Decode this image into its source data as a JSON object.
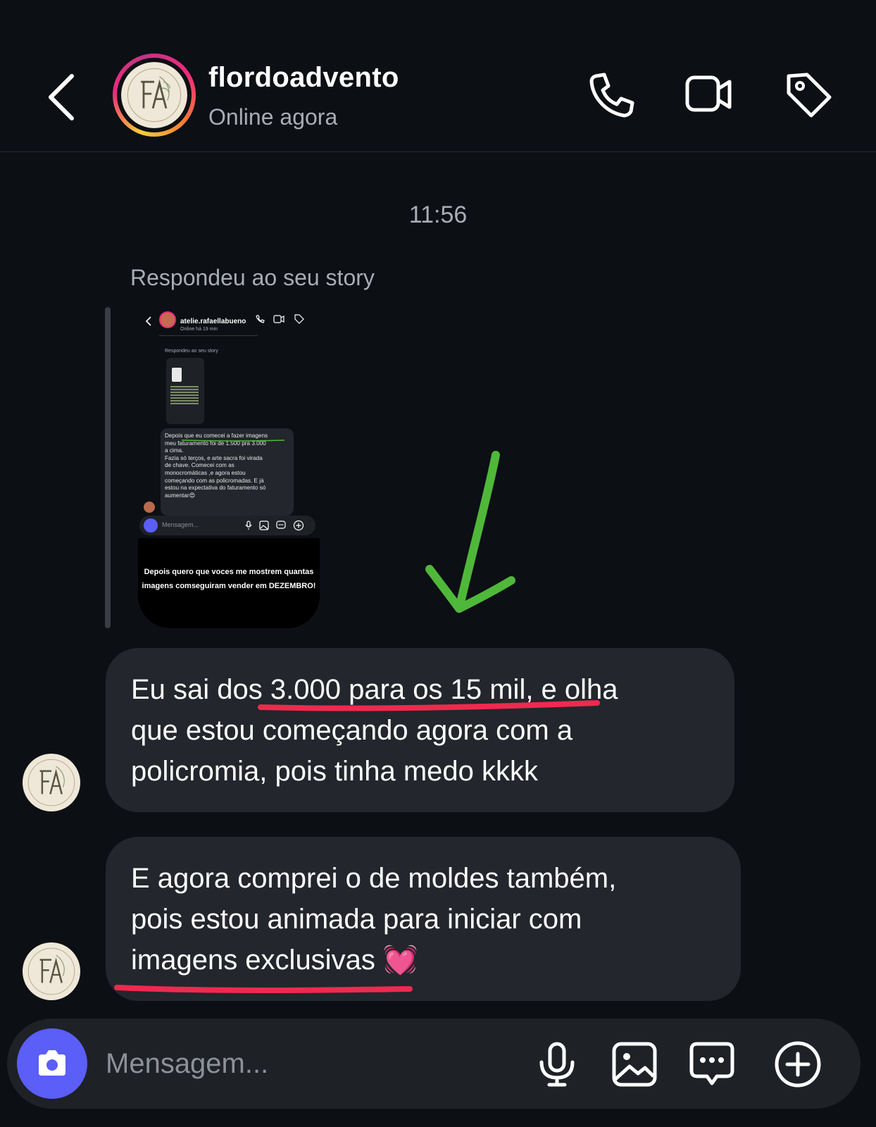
{
  "header": {
    "username": "flordoadvento",
    "status": "Online agora",
    "icons": [
      "back-chevron-icon",
      "phone-icon",
      "video-icon",
      "tag-icon"
    ]
  },
  "chat": {
    "timestamp": "11:56",
    "reply_label": "Respondeu ao seu story",
    "story_preview": {
      "username": "atelie.rafaellabueno",
      "status": "Online há 19 min",
      "reply_label": "Respondeu ao seu story",
      "message": "Depois que eu comecei a fazer imagens\nmeu faturamento foi de 1.500 pra 3.000\na cima.\nFazia só terços, e arte sacra foi virada\nde chave. Comecei com as\nmonocromáticas ,e agora estou\ncomeçando com as policromadas. E já\nestou na expectativa do faturamento só\naumentar😍",
      "input_placeholder": "Mensagem...",
      "caption": "Depois quero que voces me mostrem quantas\nimagens comseguiram vender em DEZEMBRO!"
    },
    "messages": [
      {
        "lines": [
          "Eu sai dos 3.000 para os 15 mil, e olha",
          "que estou começando agora com a",
          "policromia, pois tinha medo kkkk"
        ]
      },
      {
        "lines": [
          "E agora comprei o de moldes também,",
          "pois estou animada para iniciar com",
          "imagens exclusivas 💓"
        ]
      }
    ],
    "annotation_colors": {
      "arrow": "#4fb83a",
      "underline": "#ee2a4f"
    }
  },
  "composer": {
    "placeholder": "Mensagem...",
    "accent": "#5b5ef7",
    "icons": [
      "camera-icon",
      "microphone-icon",
      "gallery-icon",
      "sticker-icon",
      "plus-icon"
    ]
  }
}
